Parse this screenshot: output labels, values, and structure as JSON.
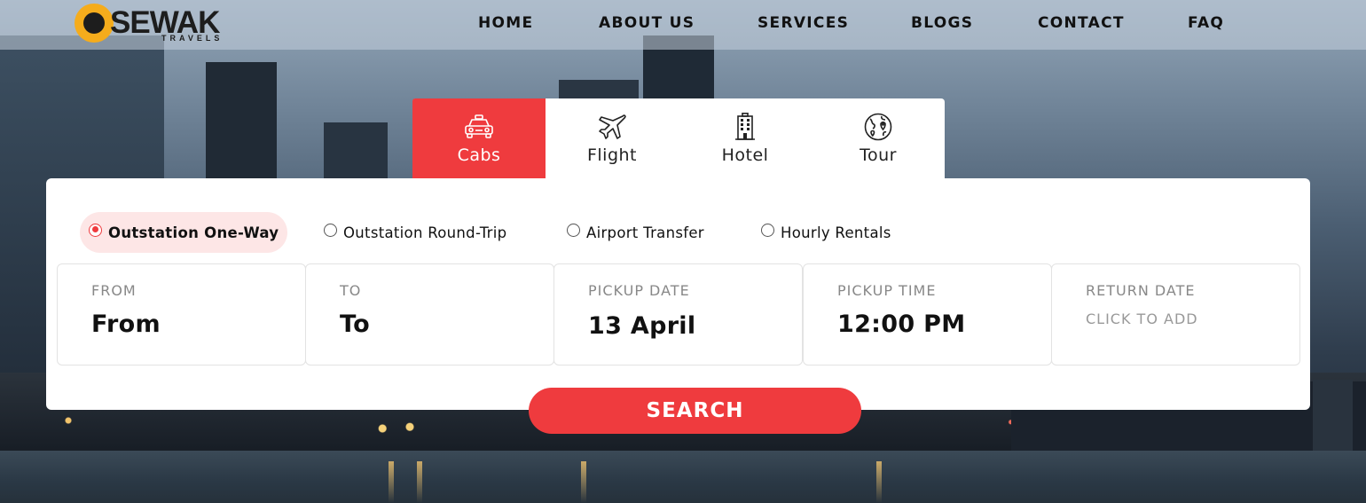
{
  "brand": {
    "name": "SEWAK",
    "tagline": "TRAVELS",
    "accent_color": "#ef3b3e",
    "logo_color": "#f5ac1c"
  },
  "nav": {
    "items": [
      {
        "label": "HOME"
      },
      {
        "label": "ABOUT US"
      },
      {
        "label": "SERVICES"
      },
      {
        "label": "BLOGS"
      },
      {
        "label": "CONTACT"
      },
      {
        "label": "FAQ"
      }
    ]
  },
  "tabs": [
    {
      "label": "Cabs",
      "icon": "taxi-icon",
      "active": true
    },
    {
      "label": "Flight",
      "icon": "airplane-icon",
      "active": false
    },
    {
      "label": "Hotel",
      "icon": "hotel-building-icon",
      "active": false
    },
    {
      "label": "Tour",
      "icon": "globe-map-icon",
      "active": false
    }
  ],
  "trip_types": [
    {
      "label": "Outstation One-Way",
      "selected": true
    },
    {
      "label": "Outstation Round-Trip",
      "selected": false
    },
    {
      "label": "Airport Transfer",
      "selected": false
    },
    {
      "label": "Hourly Rentals",
      "selected": false
    }
  ],
  "fields": {
    "from": {
      "caption": "FROM",
      "value": "From"
    },
    "to": {
      "caption": "TO",
      "value": "To"
    },
    "pickup_date": {
      "caption": "PICKUP DATE",
      "value": "13 April"
    },
    "pickup_time": {
      "caption": "PICKUP TIME",
      "value": "12:00 PM"
    },
    "return_date": {
      "caption": "RETURN DATE",
      "placeholder": "CLICK TO ADD"
    }
  },
  "search": {
    "label": "SEARCH"
  }
}
